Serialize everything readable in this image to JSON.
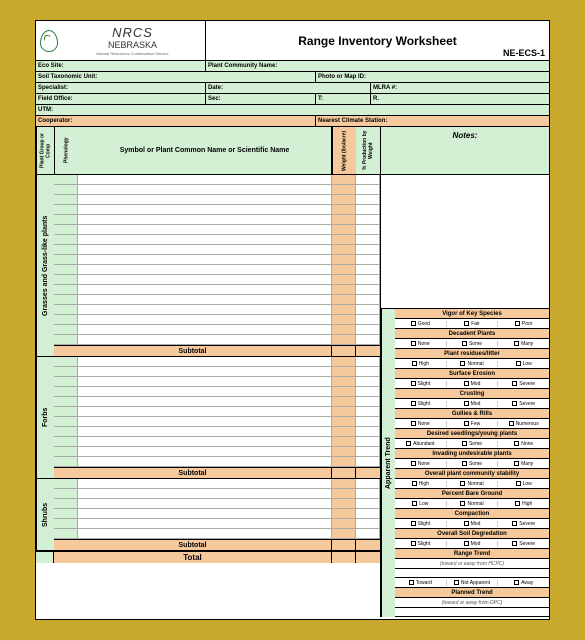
{
  "header": {
    "org": "NRCS",
    "state": "NEBRASKA",
    "sub": "Natural Resources Conservation Service",
    "title": "Range Inventory Worksheet",
    "code": "NE-ECS-1"
  },
  "fields": {
    "eco_site": "Eco Site:",
    "plant_community": "Plant Community Name:",
    "soil_tax": "Soil Taxonomic Unit:",
    "photo": "Photo or Map ID:",
    "specialist": "Specialist:",
    "date": "Date:",
    "mlra": "MLRA #:",
    "field_office": "Field Office:",
    "sec": "Sec:",
    "t": "T:",
    "r": "R.",
    "utm": "UTM:",
    "cooperator": "Cooperator:",
    "nearest_climate": "Nearest Climate Station:"
  },
  "cols": {
    "group": "Plant Group or Comp",
    "phen": "Phenology",
    "symbol": "Symbol or Plant Common Name or Scientific Name",
    "weight": "Weight (lbs/acre)",
    "pct": "% Production by Weight"
  },
  "sections": {
    "grasses": "Grasses and Grass-like plants",
    "forbs": "Forbs",
    "shrubs": "Shrubs",
    "subtotal": "Subtotal",
    "total": "Total"
  },
  "notes": "Notes:",
  "apparent_trend": "Apparent Trend",
  "assess": {
    "vigor": "Vigor of Key Species",
    "vigor_opts": [
      "Good",
      "Fair",
      "Poor"
    ],
    "decadent": "Decadent Plants",
    "nsm": [
      "None",
      "Some",
      "Many"
    ],
    "residues": "Plant residues/litter",
    "hnl": [
      "High",
      "Normal",
      "Low"
    ],
    "surface": "Surface Erosion",
    "sms": [
      "Slight",
      "Mod",
      "Severe"
    ],
    "crusting": "Crusting",
    "gullies": "Gullies & Rills",
    "nfn": [
      "None",
      "Few",
      "Numerous"
    ],
    "desired": "Desired seedlings/young plants",
    "asn": [
      "Abundant",
      "Some",
      "None"
    ],
    "invading": "Invading undesirable plants",
    "overall_comm": "Overall plant community stability",
    "bare": "Percent Bare Ground",
    "lnh": [
      "Low",
      "Normal",
      "High"
    ],
    "compaction": "Compaction",
    "soil_deg": "Overall Soil Degredation",
    "range_trend": "Range Trend",
    "hcpc": "(toward or away from HCPC)",
    "tna": [
      "Toward",
      "Not Apparent",
      "Away"
    ],
    "planned": "Planned Trend",
    "dpc": "(toward or away from DPC)"
  }
}
